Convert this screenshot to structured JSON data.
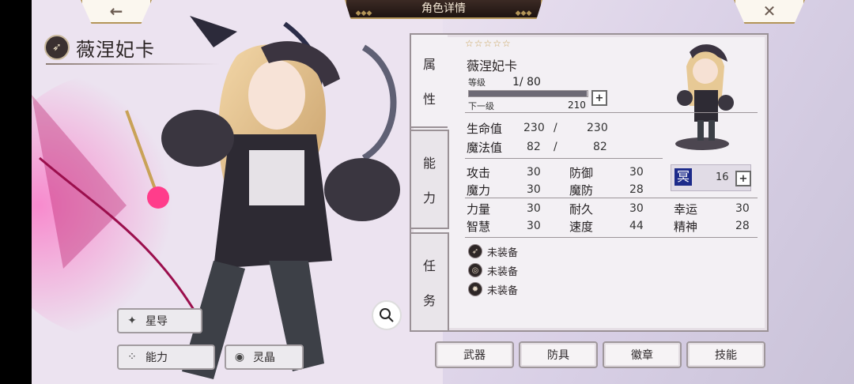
{
  "header": {
    "title": "角色详情"
  },
  "nav": {
    "back_icon": "arrow-left-icon",
    "close_icon": "close-icon"
  },
  "character": {
    "name": "薇涅妃卡",
    "stars": "☆☆☆☆☆",
    "level_label": "等级",
    "level": "1",
    "max_level": "/ 80",
    "level_progress": 0.99,
    "next_label": "下一级",
    "next_value": "210"
  },
  "tabs": [
    {
      "label_1": "属",
      "label_2": "性"
    },
    {
      "label_1": "能",
      "label_2": "力"
    },
    {
      "label_1": "任",
      "label_2": "务"
    }
  ],
  "vitals": [
    {
      "label": "生命值",
      "current": "230",
      "sep": "/",
      "max": "230"
    },
    {
      "label": "魔法值",
      "current": "82",
      "sep": "/",
      "max": "82"
    }
  ],
  "stats": {
    "attack": {
      "label": "攻击",
      "value": "30"
    },
    "defense": {
      "label": "防御",
      "value": "30"
    },
    "magic": {
      "label": "魔力",
      "value": "30"
    },
    "magic_def": {
      "label": "魔防",
      "value": "28"
    },
    "strength": {
      "label": "力量",
      "value": "30"
    },
    "endurance": {
      "label": "耐久",
      "value": "30"
    },
    "luck": {
      "label": "幸运",
      "value": "30"
    },
    "wisdom": {
      "label": "智慧",
      "value": "30"
    },
    "speed": {
      "label": "速度",
      "value": "44"
    },
    "spirit": {
      "label": "精神",
      "value": "28"
    }
  },
  "special": {
    "glyph": "冥",
    "value": "16"
  },
  "equipment": [
    {
      "label": "未装备",
      "icon": "bow-icon"
    },
    {
      "label": "未装备",
      "icon": "ring-icon"
    },
    {
      "label": "未装备",
      "icon": "emblem-icon"
    }
  ],
  "bottom_buttons": [
    "武器",
    "防具",
    "徽章",
    "技能"
  ],
  "side_buttons": {
    "star_guide": "星导",
    "ability": "能力",
    "crystal": "灵晶"
  },
  "colors": {
    "accent_gold": "#b39558",
    "panel_bg": "#f3f0f4",
    "special_blue": "#1d2b8a"
  }
}
